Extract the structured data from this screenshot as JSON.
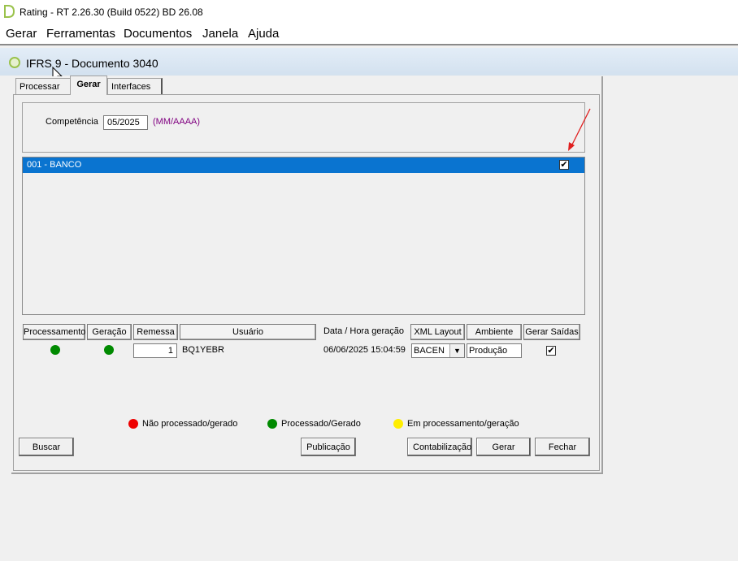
{
  "window": {
    "title": "Rating  -  RT 2.26.30 (Build 0522) BD 26.08"
  },
  "menu": [
    "Gerar",
    "Ferramentas",
    "Documentos",
    "Janela",
    "Ajuda"
  ],
  "child_window": {
    "title": "IFRS 9 - Documento 3040"
  },
  "tabs": [
    {
      "label": "Processar",
      "active": false
    },
    {
      "label": "Gerar",
      "active": true
    },
    {
      "label": "Interfaces",
      "active": false
    }
  ],
  "competencia": {
    "label": "Competência",
    "value": "05/2025",
    "hint": "(MM/AAAA)"
  },
  "list": {
    "items": [
      {
        "label": "001 - BANCO",
        "checked": true
      }
    ]
  },
  "table": {
    "headers": [
      "Processamento",
      "Geração",
      "Remessa",
      "Usuário",
      "Data / Hora geração",
      "XML Layout",
      "Ambiente",
      "Gerar Saídas"
    ],
    "row": {
      "remessa": "1",
      "usuario": "BQ1YEBR",
      "data_hora": "06/06/2025 15:04:59",
      "xml_layout": "BACEN",
      "ambiente": "Produção",
      "gerar_saidas": true
    }
  },
  "legend": [
    {
      "label": "Não processado/gerado",
      "color": "#ee0000"
    },
    {
      "label": "Processado/Gerado",
      "color": "#008a00"
    },
    {
      "label": "Em processamento/geração",
      "color": "#ffee00"
    }
  ],
  "buttons": {
    "buscar": "Buscar",
    "publicacao": "Publicação",
    "contabilizacao": "Contabilização",
    "gerar": "Gerar",
    "fechar": "Fechar"
  },
  "check_glyph": "✔",
  "colors": {
    "selection": "#0a74d0",
    "status_ok": "#008a00",
    "hint": "#800080",
    "annotation_arrow": "#e02020"
  }
}
